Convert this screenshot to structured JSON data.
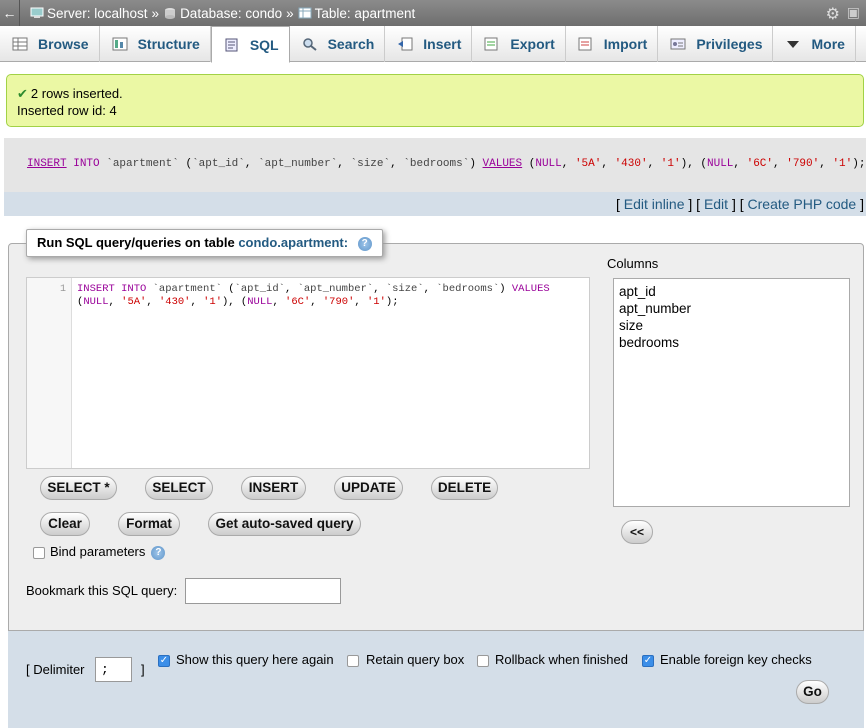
{
  "topbar": {
    "back": "←",
    "server": "Server: localhost",
    "database": "Database: condo",
    "table": "Table: apartment",
    "sep": "»"
  },
  "tabs": [
    {
      "label": "Browse",
      "icon": "browse-icon"
    },
    {
      "label": "Structure",
      "icon": "structure-icon"
    },
    {
      "label": "SQL",
      "icon": "sql-icon"
    },
    {
      "label": "Search",
      "icon": "search-icon"
    },
    {
      "label": "Insert",
      "icon": "insert-icon"
    },
    {
      "label": "Export",
      "icon": "export-icon"
    },
    {
      "label": "Import",
      "icon": "import-icon"
    },
    {
      "label": "Privileges",
      "icon": "privileges-icon"
    },
    {
      "label": "More",
      "icon": "chevron-down-icon"
    }
  ],
  "message": {
    "line1": "2 rows inserted.",
    "line2": "Inserted row id: 4"
  },
  "query": {
    "links_open": "[",
    "edit_inline": "Edit inline",
    "edit": "Edit",
    "create_php": "Create PHP code",
    "links_close": "]",
    "links_mid": "] ["
  },
  "sql_panel": {
    "legend_prefix": "Run SQL query/queries on table",
    "legend_table": "condo.apartment:",
    "line_number": "1",
    "buttons": {
      "select_star": "SELECT *",
      "select": "SELECT",
      "insert": "INSERT",
      "update": "UPDATE",
      "delete": "DELETE",
      "clear": "Clear",
      "format": "Format",
      "autosaved": "Get auto-saved query"
    },
    "bind_parameters": "Bind parameters",
    "columns_label": "Columns",
    "columns": [
      "apt_id",
      "apt_number",
      "size",
      "bedrooms"
    ],
    "insert_column_button": "<<",
    "bookmark_label": "Bookmark this SQL query:",
    "bookmark_value": ""
  },
  "options": {
    "delimiter_label_open": "[ Delimiter",
    "delimiter_value": ";",
    "delimiter_label_close": "]",
    "show_query": "Show this query here again",
    "retain_box": "Retain query box",
    "rollback": "Rollback when finished",
    "foreign_keys": "Enable foreign key checks",
    "go": "Go"
  }
}
